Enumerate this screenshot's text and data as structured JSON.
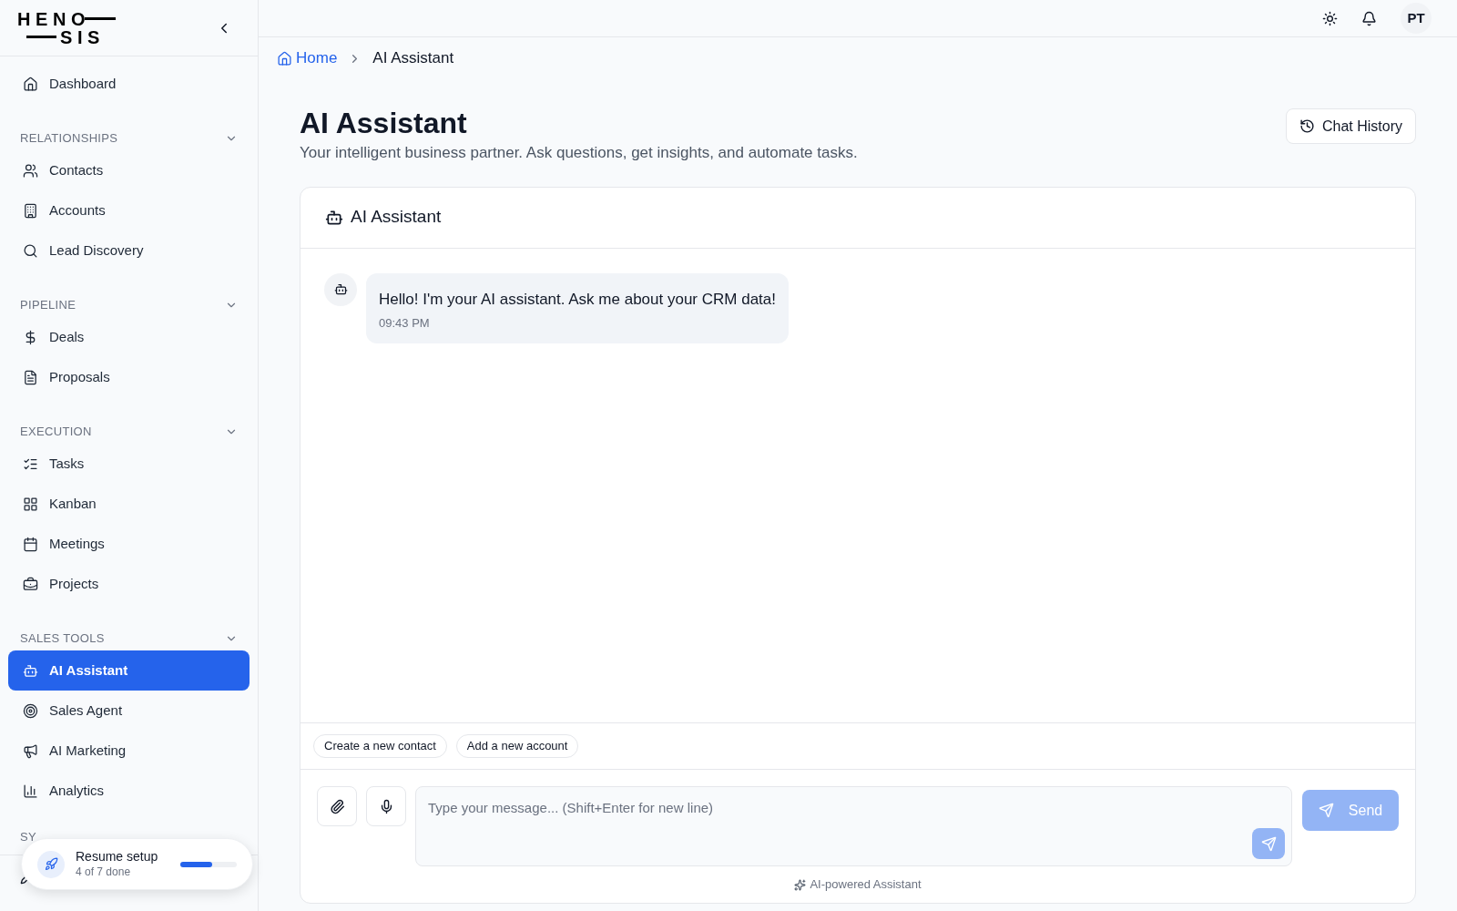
{
  "sidebar": {
    "logo": [
      "HENO",
      "SIS"
    ],
    "top_items": [
      {
        "label": "Dashboard",
        "selected": false
      }
    ],
    "sections": [
      {
        "label": "RELATIONSHIPS",
        "expanded": true,
        "items": [
          {
            "label": "Contacts",
            "selected": false
          },
          {
            "label": "Accounts",
            "selected": false
          },
          {
            "label": "Lead Discovery",
            "selected": false
          }
        ]
      },
      {
        "label": "PIPELINE",
        "expanded": true,
        "items": [
          {
            "label": "Deals",
            "selected": false
          },
          {
            "label": "Proposals",
            "selected": false
          }
        ]
      },
      {
        "label": "EXECUTION",
        "expanded": true,
        "items": [
          {
            "label": "Tasks",
            "selected": false
          },
          {
            "label": "Kanban",
            "selected": false
          },
          {
            "label": "Meetings",
            "selected": false
          },
          {
            "label": "Projects",
            "selected": false
          }
        ]
      },
      {
        "label": "SALES TOOLS",
        "expanded": true,
        "items": [
          {
            "label": "AI Assistant",
            "selected": true
          },
          {
            "label": "Sales Agent",
            "selected": false
          },
          {
            "label": "AI Marketing",
            "selected": false
          },
          {
            "label": "Analytics",
            "selected": false
          }
        ]
      }
    ],
    "cut_section_label": "SY",
    "setup": {
      "title": "Resume setup",
      "subtitle": "4 of 7 done",
      "level": 0.57
    }
  },
  "header": {
    "avatar": "PT"
  },
  "breadcrumb": [
    "Home",
    "AI Assistant"
  ],
  "page": {
    "title": "AI Assistant",
    "subtitle": "Your intelligent business partner. Ask questions, get insights, and automate tasks.",
    "history_button": "Chat History"
  },
  "chat": {
    "title": "AI Assistant",
    "messages": [
      {
        "text": "Hello! I'm your AI assistant. Ask me about your CRM data!",
        "time": "09:43 PM"
      }
    ],
    "suggestions": [
      "Create a new contact",
      "Add a new account"
    ],
    "input": {
      "placeholder": "Type your message... (Shift+Enter for new line)"
    },
    "send_button": "Send",
    "footer": "AI-powered Assistant"
  }
}
